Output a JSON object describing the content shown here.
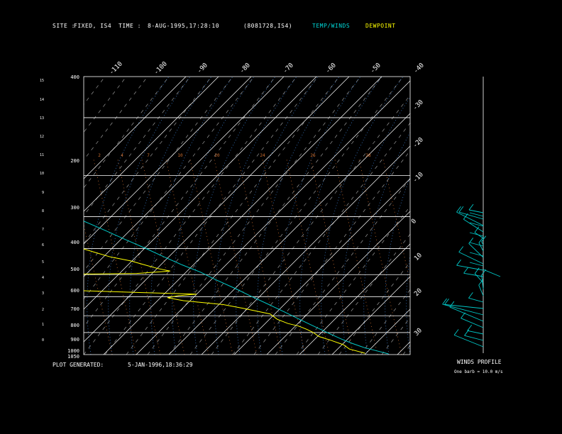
{
  "header": {
    "site_label": "SITE :",
    "site_value": "FIXED, IS4",
    "time_label": "TIME :",
    "time_value": "8-AUG-1995,17:28:10",
    "run_id": "(8081728,IS4)",
    "legend_temp": "TEMP/WINDS",
    "legend_dew": "DEWPOINT"
  },
  "footer": {
    "generated_label": "PLOT GENERATED:",
    "generated_value": "5-JAN-1996,18:36:29",
    "wind_title": "WINDS PROFILE",
    "wind_note": "One barb = 10.0 m/s"
  },
  "colors": {
    "temperature": "#00c8c8",
    "dewpoint": "#ffff00",
    "isotherm": "#ffffff",
    "mixing_ratio": "#d07030",
    "moist_adiabat": "#3a7ac8",
    "dry_adiabat": "#ffffff"
  },
  "chart_data": {
    "type": "line",
    "diagram": "skew-T log-P",
    "pressure_levels": [
      400,
      200,
      300,
      400,
      500,
      600,
      700,
      800,
      900,
      1000,
      1050
    ],
    "pressure_tick_labels": [
      "400",
      "200",
      "300",
      "400",
      "500",
      "600",
      "700",
      "800",
      "900",
      "1000",
      "1050"
    ],
    "height_km_ticks": [
      "15",
      "14",
      "13",
      "12",
      "11",
      "10",
      "9",
      "8",
      "7",
      "6",
      "5",
      "4",
      "3",
      "2",
      "1",
      "0"
    ],
    "top_isotherm_labels": [
      "-110",
      "-100",
      "-90",
      "-80",
      "-70",
      "-60",
      "-50",
      "-40"
    ],
    "right_isotherm_labels": [
      "-30",
      "-20",
      "-10",
      "0",
      "10",
      "20",
      "30"
    ],
    "mixing_ratio_labels": [
      "2",
      "4",
      "7",
      "10",
      "20",
      "24",
      "26",
      "28"
    ],
    "series": [
      {
        "name": "TEMP/WINDS",
        "points": [
          {
            "p": 1045,
            "t": 27.5
          },
          {
            "p": 1020,
            "t": 24.5
          },
          {
            "p": 1000,
            "t": 22.0
          },
          {
            "p": 970,
            "t": 19.5
          },
          {
            "p": 940,
            "t": 17.5
          },
          {
            "p": 910,
            "t": 15.8
          },
          {
            "p": 880,
            "t": 14.2
          },
          {
            "p": 850,
            "t": 12.5
          },
          {
            "p": 820,
            "t": 10.8
          },
          {
            "p": 780,
            "t": 8.5
          },
          {
            "p": 740,
            "t": 6.0
          },
          {
            "p": 700,
            "t": 3.2
          },
          {
            "p": 660,
            "t": 0.5
          },
          {
            "p": 620,
            "t": -2.8
          },
          {
            "p": 590,
            "t": -5.0
          },
          {
            "p": 560,
            "t": -8.5
          },
          {
            "p": 530,
            "t": -11.5
          },
          {
            "p": 500,
            "t": -14.5
          },
          {
            "p": 470,
            "t": -18.0
          },
          {
            "p": 440,
            "t": -21.5
          },
          {
            "p": 410,
            "t": -25.5
          },
          {
            "p": 390,
            "t": -28.5
          },
          {
            "p": 375,
            "t": -30.5
          }
        ]
      },
      {
        "name": "DEWPOINT",
        "points": [
          {
            "p": 1040,
            "t": 20.5
          },
          {
            "p": 1010,
            "t": 17.0
          },
          {
            "p": 980,
            "t": 16.5
          },
          {
            "p": 950,
            "t": 14.0
          },
          {
            "p": 925,
            "t": 11.5
          },
          {
            "p": 900,
            "t": 11.0
          },
          {
            "p": 880,
            "t": 10.0
          },
          {
            "p": 860,
            "t": 8.5
          },
          {
            "p": 845,
            "t": 6.0
          },
          {
            "p": 820,
            "t": 4.0
          },
          {
            "p": 790,
            "t": 3.5
          },
          {
            "p": 760,
            "t": -3.0
          },
          {
            "p": 740,
            "t": -8.0
          },
          {
            "p": 720,
            "t": -19.0
          },
          {
            "p": 705,
            "t": -23.0
          },
          {
            "p": 695,
            "t": -19.0
          },
          {
            "p": 688,
            "t": -13.0
          },
          {
            "p": 680,
            "t": -30.0
          },
          {
            "p": 670,
            "t": -50.0
          },
          {
            "p": 660,
            "t": -63.0
          },
          {
            "p": 640,
            "t": -70.0
          },
          {
            "p": 620,
            "t": -75.0
          },
          {
            "p": 600,
            "t": -76.0
          },
          {
            "p": 598,
            "t": -45.0
          },
          {
            "p": 595,
            "t": -25.0
          },
          {
            "p": 585,
            "t": -14.0
          },
          {
            "p": 575,
            "t": -17.0
          },
          {
            "p": 560,
            "t": -20.0
          },
          {
            "p": 545,
            "t": -23.0
          },
          {
            "p": 530,
            "t": -28.0
          },
          {
            "p": 515,
            "t": -31.0
          },
          {
            "p": 500,
            "t": -34.0
          },
          {
            "p": 490,
            "t": -39.0
          },
          {
            "p": 480,
            "t": -41.0
          },
          {
            "p": 470,
            "t": -39.5
          },
          {
            "p": 455,
            "t": -40.5
          },
          {
            "p": 440,
            "t": -42.0
          },
          {
            "p": 425,
            "t": -43.5
          },
          {
            "p": 410,
            "t": -45.0
          },
          {
            "p": 400,
            "t": -46.5
          },
          {
            "p": 385,
            "t": -48.0
          },
          {
            "p": 370,
            "t": -48.5
          }
        ]
      }
    ],
    "wind_profile_shafts": 22,
    "y_axis": "pressure (log scale, reversed)",
    "x_axis": "temperature (skewed)",
    "grid": true
  }
}
